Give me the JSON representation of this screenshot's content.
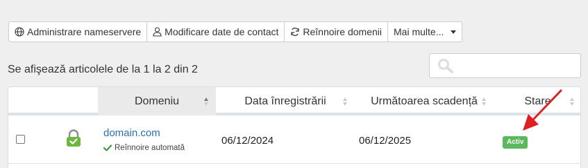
{
  "toolbar": {
    "nameservers_label": "Administrare nameservere",
    "contact_label": "Modificare date de contact",
    "renew_label": "Reînnoire domenii",
    "more_label": "Mai multe..."
  },
  "listing": {
    "showing_text": "Se afişează articolele de la 1 la 2 din 2",
    "search_placeholder": ""
  },
  "table": {
    "headers": {
      "domain": "Domeniu",
      "registration": "Data înregistrării",
      "next_due": "Următoarea scadență",
      "status": "Stare"
    },
    "rows": [
      {
        "domain": "domain.com",
        "auto_renew": "Reînnoire automată",
        "registered": "06/12/2024",
        "next_due": "06/12/2025",
        "status": "Activ"
      }
    ]
  },
  "colors": {
    "link": "#2a6ebb",
    "status_active": "#5cb85c",
    "lock_icon": "#6fb63f",
    "annotation_arrow": "#e02020"
  },
  "icons": [
    "globe-icon",
    "user-icon",
    "refresh-icon",
    "caret-down-icon",
    "search-icon",
    "lock-icon",
    "check-icon"
  ]
}
